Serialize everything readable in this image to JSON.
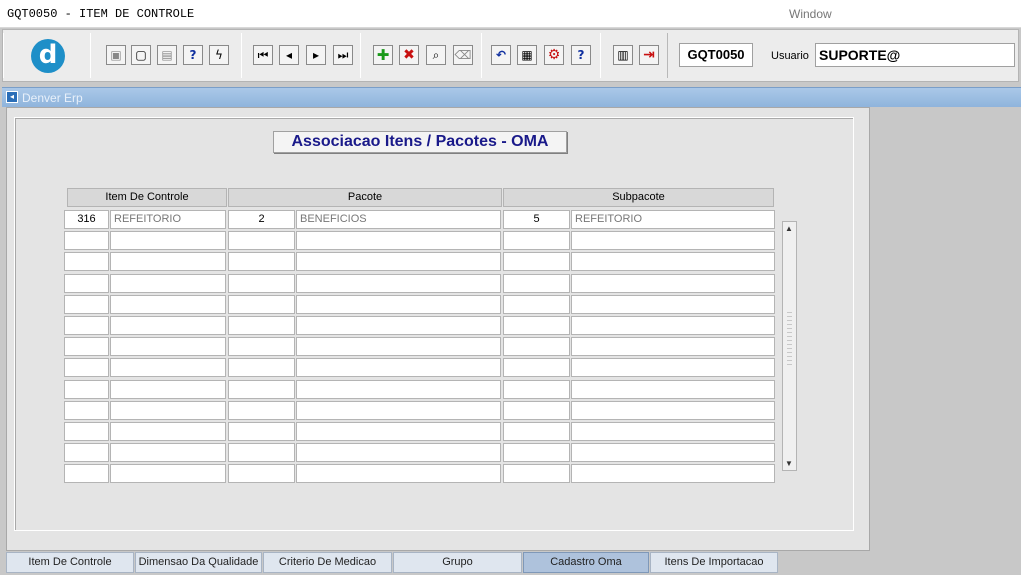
{
  "window": {
    "title": "GQT0050 - ITEM DE CONTROLE",
    "menu": "Window"
  },
  "toolbar": {
    "code": "GQT0050",
    "user_label": "Usuario",
    "user_value": "SUPORTE@",
    "logo_letter": "d",
    "buttons": [
      {
        "name": "save-icon",
        "glyph": "▣"
      },
      {
        "name": "screen-icon",
        "glyph": "▢"
      },
      {
        "name": "print-icon",
        "glyph": "▤"
      },
      {
        "name": "query-icon",
        "glyph": "?"
      },
      {
        "name": "execute-query-icon",
        "glyph": "ϟ"
      },
      {
        "name": "first-record-icon",
        "glyph": "⏮"
      },
      {
        "name": "previous-record-icon",
        "glyph": "◂"
      },
      {
        "name": "next-record-icon",
        "glyph": "▸"
      },
      {
        "name": "last-record-icon",
        "glyph": "⏭"
      },
      {
        "name": "insert-record-icon",
        "glyph": "✚"
      },
      {
        "name": "delete-record-icon",
        "glyph": "✖"
      },
      {
        "name": "search-record-icon",
        "glyph": "⌕"
      },
      {
        "name": "clear-icon",
        "glyph": "⌫"
      },
      {
        "name": "undo-icon",
        "glyph": "↶"
      },
      {
        "name": "list-icon",
        "glyph": "▦"
      },
      {
        "name": "tools-icon",
        "glyph": "⚙"
      },
      {
        "name": "help-icon",
        "glyph": "?"
      },
      {
        "name": "menu-icon",
        "glyph": "▥"
      },
      {
        "name": "exit-icon",
        "glyph": "⇥"
      }
    ]
  },
  "app_bar": {
    "label": "Denver Erp"
  },
  "form": {
    "heading": "Associacao Itens / Pacotes - OMA",
    "columns": [
      "Item De Controle",
      "Pacote",
      "Subpacote"
    ],
    "rows": [
      [
        "316",
        "REFEITORIO",
        "2",
        "BENEFICIOS",
        "5",
        "REFEITORIO"
      ],
      [
        "",
        "",
        "",
        "",
        "",
        ""
      ],
      [
        "",
        "",
        "",
        "",
        "",
        ""
      ],
      [
        "",
        "",
        "",
        "",
        "",
        ""
      ],
      [
        "",
        "",
        "",
        "",
        "",
        ""
      ],
      [
        "",
        "",
        "",
        "",
        "",
        ""
      ],
      [
        "",
        "",
        "",
        "",
        "",
        ""
      ],
      [
        "",
        "",
        "",
        "",
        "",
        ""
      ],
      [
        "",
        "",
        "",
        "",
        "",
        ""
      ],
      [
        "",
        "",
        "",
        "",
        "",
        ""
      ],
      [
        "",
        "",
        "",
        "",
        "",
        ""
      ],
      [
        "",
        "",
        "",
        "",
        "",
        ""
      ],
      [
        "",
        "",
        "",
        "",
        "",
        ""
      ]
    ]
  },
  "tabs": [
    {
      "label": "Item De Controle",
      "active": false
    },
    {
      "label": "Dimensao Da Qualidade",
      "active": false
    },
    {
      "label": "Criterio De Medicao",
      "active": false
    },
    {
      "label": "Grupo",
      "active": false
    },
    {
      "label": "Cadastro Oma",
      "active": true
    },
    {
      "label": "Itens De Importacao",
      "active": false
    }
  ]
}
